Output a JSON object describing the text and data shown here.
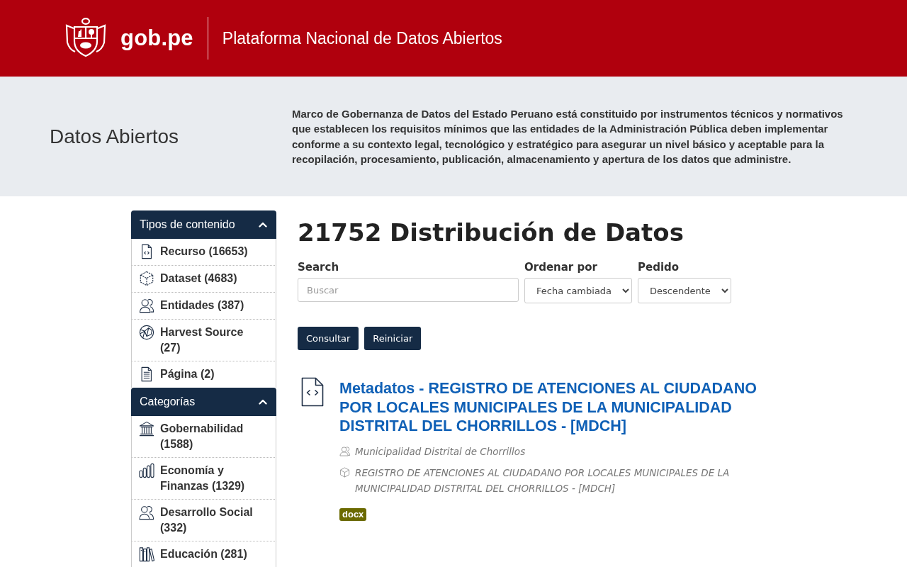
{
  "header": {
    "brand": "gob.pe",
    "title": "Plataforma Nacional de Datos Abiertos"
  },
  "banner": {
    "title": "Datos Abiertos",
    "description": "Marco de Gobernanza de Datos del Estado Peruano está constituido por instrumentos técnicos y normativos que establecen los requisitos mínimos que las entidades de la Administración Pública deben implementar conforme a su contexto legal, tecnológico y estratégico para asegurar un nivel básico y aceptable para la recopilación, procesamiento, publicación, almacenamiento y apertura de los datos que administre."
  },
  "sidebar": {
    "sections": [
      {
        "title": "Tipos de contenido",
        "expanded": true,
        "items": [
          {
            "label": "Recurso (16653)",
            "kind": "resource"
          },
          {
            "label": "Dataset (4683)",
            "kind": "dataset"
          },
          {
            "label": "Entidades (387)",
            "kind": "entity"
          },
          {
            "label": "Harvest Source (27)",
            "kind": "harvest"
          },
          {
            "label": "Página (2)",
            "kind": "page"
          }
        ]
      },
      {
        "title": "Categorías",
        "expanded": true,
        "items": [
          {
            "label": "Gobernabilidad (1588)",
            "kind": "governance"
          },
          {
            "label": "Economía y Finanzas (1329)",
            "kind": "economy"
          },
          {
            "label": "Desarrollo Social (332)",
            "kind": "social"
          },
          {
            "label": "Educación (281)",
            "kind": "education"
          }
        ]
      }
    ]
  },
  "main": {
    "heading": "21752 Distribución de Datos",
    "search": {
      "label": "Search",
      "placeholder": "Buscar"
    },
    "sort": {
      "label": "Ordenar por",
      "value": "Fecha cambiada"
    },
    "order": {
      "label": "Pedido",
      "value": "Descendente"
    },
    "buttons": [
      "Consultar",
      "Reiniciar"
    ],
    "results": [
      {
        "kind": "resource",
        "title": "Metadatos - REGISTRO DE ATENCIONES AL CIUDADANO POR LOCALES MUNICIPALES DE LA MUNICIPALIDAD DISTRITAL DEL CHORRILLOS - [MDCH]",
        "entity": "Municipalidad Distrital de Chorrillos",
        "dataset": "REGISTRO DE ATENCIONES AL CIUDADANO POR LOCALES MUNICIPALES DE LA MUNICIPALIDAD DISTRITAL DEL CHORRILLOS - [MDCH]",
        "formats": [
          {
            "label": "docx",
            "color": "#6b6a00"
          }
        ]
      }
    ]
  }
}
